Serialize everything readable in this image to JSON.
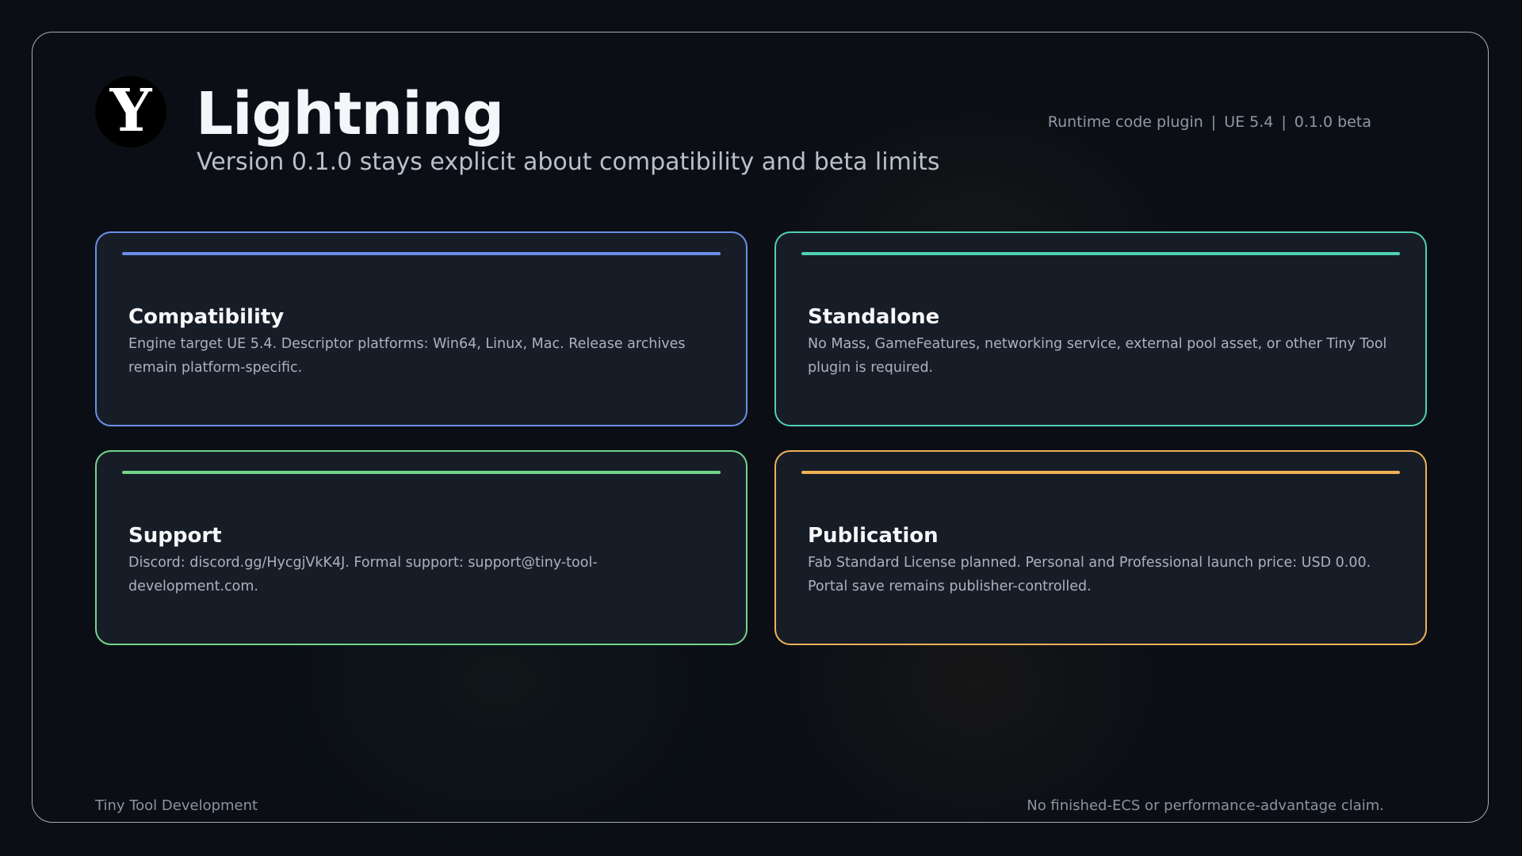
{
  "header": {
    "logo_glyph": "Y",
    "title": "Lightning",
    "subtitle": "Version 0.1.0 stays explicit about compatibility and beta limits",
    "meta": {
      "type": "Runtime code plugin",
      "engine": "UE 5.4",
      "version": "0.1.0 beta",
      "separator": "|"
    }
  },
  "cards": [
    {
      "title": "Compatibility",
      "body": "Engine target UE 5.4. Descriptor platforms: Win64, Linux, Mac. Release archives remain platform-specific.",
      "accent": "#6a8fe8"
    },
    {
      "title": "Standalone",
      "body": "No Mass, GameFeatures, networking service, external pool asset, or other Tiny Tool plugin is required.",
      "accent": "#4fd0b4"
    },
    {
      "title": "Support",
      "body": "Discord: discord.gg/HycgjVkK4J. Formal support: support@tiny-tool-development.com.",
      "accent": "#72d58a"
    },
    {
      "title": "Publication",
      "body": "Fab Standard License planned. Personal and Professional launch price: USD 0.00. Portal save remains publisher-controlled.",
      "accent": "#f0b254"
    }
  ],
  "footer": {
    "left": "Tiny Tool Development",
    "right": "No finished-ECS or performance-advantage claim."
  },
  "colors": {
    "background": "#0b0f15",
    "card_background": "#171d27",
    "frame_border": "#dce1e8"
  }
}
